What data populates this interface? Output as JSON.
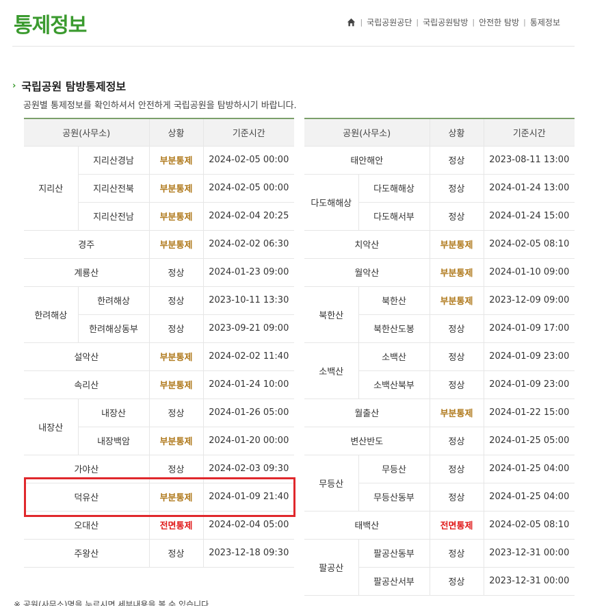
{
  "header": {
    "title": "통제정보",
    "breadcrumb": [
      "국립공원공단",
      "국립공원탐방",
      "안전한 탐방",
      "통제정보"
    ]
  },
  "section": {
    "title": "국립공원 탐방통제정보",
    "description": "공원별 통제정보를 확인하셔서 안전하게 국립공원을 탐방하시기 바랍니다."
  },
  "table_headers": {
    "park": "공원(사무소)",
    "status": "상황",
    "time": "기준시간"
  },
  "left_table": [
    {
      "park": "지리산",
      "sub": "지리산경남",
      "status": "부분통제",
      "status_type": "part",
      "time": "2024-02-05 00:00",
      "rowspan": 3
    },
    {
      "sub": "지리산전북",
      "status": "부분통제",
      "status_type": "part",
      "time": "2024-02-05 00:00"
    },
    {
      "sub": "지리산전남",
      "status": "부분통제",
      "status_type": "part",
      "time": "2024-02-04 20:25"
    },
    {
      "park": "경주",
      "status": "부분통제",
      "status_type": "part",
      "time": "2024-02-02 06:30"
    },
    {
      "park": "계룡산",
      "status": "정상",
      "status_type": "normal",
      "time": "2024-01-23 09:00"
    },
    {
      "park": "한려해상",
      "sub": "한려해상",
      "status": "정상",
      "status_type": "normal",
      "time": "2023-10-11 13:30",
      "rowspan": 2
    },
    {
      "sub": "한려해상동부",
      "status": "정상",
      "status_type": "normal",
      "time": "2023-09-21 09:00"
    },
    {
      "park": "설악산",
      "status": "부분통제",
      "status_type": "part",
      "time": "2024-02-02 11:40"
    },
    {
      "park": "속리산",
      "status": "부분통제",
      "status_type": "part",
      "time": "2024-01-24 10:00"
    },
    {
      "park": "내장산",
      "sub": "내장산",
      "status": "정상",
      "status_type": "normal",
      "time": "2024-01-26 05:00",
      "rowspan": 2
    },
    {
      "sub": "내장백암",
      "status": "부분통제",
      "status_type": "part",
      "time": "2024-01-20 00:00"
    },
    {
      "park": "가야산",
      "status": "정상",
      "status_type": "normal",
      "time": "2024-02-03 09:30"
    },
    {
      "park": "덕유산",
      "status": "부분통제",
      "status_type": "part",
      "time": "2024-01-09 21:40"
    },
    {
      "park": "오대산",
      "status": "전면통제",
      "status_type": "full",
      "time": "2024-02-04 05:00"
    },
    {
      "park": "주왕산",
      "status": "정상",
      "status_type": "normal",
      "time": "2023-12-18 09:30"
    }
  ],
  "right_table": [
    {
      "park": "태안해안",
      "status": "정상",
      "status_type": "normal",
      "time": "2023-08-11 13:00"
    },
    {
      "park": "다도해해상",
      "sub": "다도해해상",
      "status": "정상",
      "status_type": "normal",
      "time": "2024-01-24 13:00",
      "rowspan": 2
    },
    {
      "sub": "다도해서부",
      "status": "정상",
      "status_type": "normal",
      "time": "2024-01-24 15:00"
    },
    {
      "park": "치악산",
      "status": "부분통제",
      "status_type": "part",
      "time": "2024-02-05 08:10"
    },
    {
      "park": "월악산",
      "status": "부분통제",
      "status_type": "part",
      "time": "2024-01-10 09:00"
    },
    {
      "park": "북한산",
      "sub": "북한산",
      "status": "부분통제",
      "status_type": "part",
      "time": "2023-12-09 09:00",
      "rowspan": 2
    },
    {
      "sub": "북한산도봉",
      "status": "정상",
      "status_type": "normal",
      "time": "2024-01-09 17:00"
    },
    {
      "park": "소백산",
      "sub": "소백산",
      "status": "정상",
      "status_type": "normal",
      "time": "2024-01-09 23:00",
      "rowspan": 2
    },
    {
      "sub": "소백산북부",
      "status": "정상",
      "status_type": "normal",
      "time": "2024-01-09 23:00"
    },
    {
      "park": "월출산",
      "status": "부분통제",
      "status_type": "part",
      "time": "2024-01-22 15:00"
    },
    {
      "park": "변산반도",
      "status": "정상",
      "status_type": "normal",
      "time": "2024-01-25 05:00"
    },
    {
      "park": "무등산",
      "sub": "무등산",
      "status": "정상",
      "status_type": "normal",
      "time": "2024-01-25 04:00",
      "rowspan": 2
    },
    {
      "sub": "무등산동부",
      "status": "정상",
      "status_type": "normal",
      "time": "2024-01-25 04:00"
    },
    {
      "park": "태백산",
      "status": "전면통제",
      "status_type": "full",
      "time": "2024-02-05 08:10"
    },
    {
      "park": "팔공산",
      "sub": "팔공산동부",
      "status": "정상",
      "status_type": "normal",
      "time": "2023-12-31 00:00",
      "rowspan": 2
    },
    {
      "sub": "팔공산서부",
      "status": "정상",
      "status_type": "normal",
      "time": "2023-12-31 00:00"
    }
  ],
  "footnote": "※ 공원(사무소)명을 누르시면 세부내용을 볼 수 있습니다."
}
